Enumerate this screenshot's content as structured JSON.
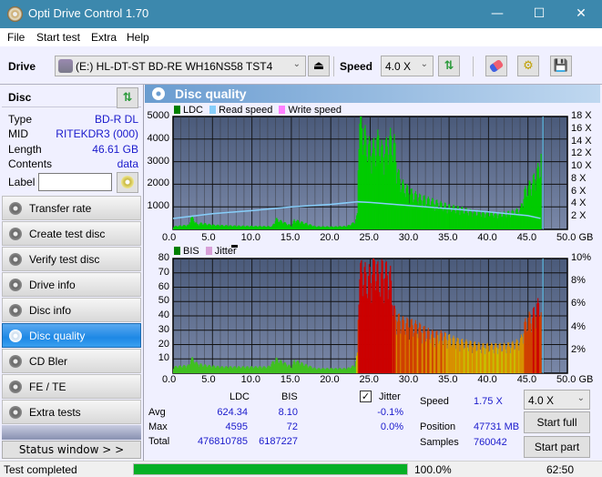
{
  "window": {
    "title": "Opti Drive Control 1.70",
    "minimize": "—",
    "maximize": "☐",
    "close": "✕"
  },
  "menu": [
    "File",
    "Start test",
    "Extra",
    "Help"
  ],
  "toolbar": {
    "drive_label": "Drive",
    "drive_value": "(E:)  HL-DT-ST BD-RE  WH16NS58 TST4",
    "speed_label": "Speed",
    "speed_value": "4.0 X",
    "icons": [
      "eject-icon",
      "refresh-icon",
      "erase-icon",
      "settings-icon",
      "save-icon"
    ]
  },
  "disc": {
    "header": "Disc",
    "rows": [
      {
        "key": "Type",
        "value": "BD-R DL"
      },
      {
        "key": "MID",
        "value": "RITEKDR3 (000)"
      },
      {
        "key": "Length",
        "value": "46.61 GB"
      },
      {
        "key": "Contents",
        "value": "data"
      }
    ],
    "label_key": "Label",
    "label_value": ""
  },
  "nav": [
    {
      "label": "Transfer rate",
      "active": false
    },
    {
      "label": "Create test disc",
      "active": false
    },
    {
      "label": "Verify test disc",
      "active": false
    },
    {
      "label": "Drive info",
      "active": false
    },
    {
      "label": "Disc info",
      "active": false
    },
    {
      "label": "Disc quality",
      "active": true
    },
    {
      "label": "CD Bler",
      "active": false
    },
    {
      "label": "FE / TE",
      "active": false
    },
    {
      "label": "Extra tests",
      "active": false
    }
  ],
  "status_window_button": "Status window > >",
  "panel_title": "Disc quality",
  "chart_data": [
    {
      "type": "area",
      "title": "LDC / Read speed",
      "legend": [
        {
          "name": "LDC",
          "color": "#008000"
        },
        {
          "name": "Read speed",
          "color": "#87cefa"
        },
        {
          "name": "Write speed",
          "color": "#ff80ff"
        }
      ],
      "xlabel": "GB",
      "xlim": [
        0,
        50
      ],
      "x_ticks": [
        "0.0",
        "5.0",
        "10.0",
        "15.0",
        "20.0",
        "25.0",
        "30.0",
        "35.0",
        "40.0",
        "45.0",
        "50.0 GB"
      ],
      "ylim": [
        0,
        5000
      ],
      "y_ticks": [
        "5000",
        "4000",
        "3000",
        "2000",
        "1000"
      ],
      "y2lim": [
        0,
        18
      ],
      "y2_ticks": [
        "18 X",
        "16 X",
        "14 X",
        "12 X",
        "10 X",
        "8 X",
        "6 X",
        "4 X",
        "2 X"
      ],
      "grid": true,
      "series": [
        {
          "name": "LDC",
          "x": [
            0,
            1,
            2,
            2.2,
            3,
            3.5,
            5,
            7,
            10,
            12.5,
            13,
            15,
            15.3,
            18,
            20,
            22,
            23,
            23.3,
            23.5,
            24,
            24.5,
            25,
            25.5,
            26,
            26.5,
            27,
            27.5,
            28,
            28.5,
            29,
            30,
            31,
            32,
            33,
            34,
            35,
            36,
            37,
            38,
            39,
            40,
            41,
            42,
            43,
            44,
            44.5,
            45,
            45.5,
            46,
            46.5,
            46.7
          ],
          "values": [
            120,
            150,
            180,
            550,
            200,
            250,
            180,
            150,
            130,
            120,
            420,
            140,
            380,
            120,
            110,
            130,
            300,
            600,
            4595,
            4000,
            3500,
            3200,
            3300,
            3600,
            3100,
            3300,
            3600,
            3400,
            2200,
            1800,
            1500,
            1300,
            1200,
            1100,
            1000,
            900,
            850,
            780,
            700,
            680,
            650,
            620,
            640,
            700,
            800,
            1500,
            1700,
            1900,
            2200,
            2600,
            3300
          ]
        },
        {
          "name": "Read speed",
          "x": [
            0,
            5,
            10,
            15,
            20,
            23.4,
            25,
            30,
            35,
            40,
            45,
            46.6
          ],
          "values": [
            1.75,
            2.5,
            3.0,
            3.6,
            4.0,
            4.4,
            4.3,
            3.8,
            3.3,
            2.8,
            2.2,
            1.75
          ]
        }
      ]
    },
    {
      "type": "bar",
      "title": "BIS / Jitter",
      "legend": [
        {
          "name": "BIS",
          "color": "#008000"
        },
        {
          "name": "Jitter",
          "color": "#d8a0d8"
        }
      ],
      "xlabel": "GB",
      "xlim": [
        0,
        50
      ],
      "x_ticks": [
        "0.0",
        "5.0",
        "10.0",
        "15.0",
        "20.0",
        "25.0",
        "30.0",
        "35.0",
        "40.0",
        "45.0",
        "50.0 GB"
      ],
      "ylim": [
        0,
        80
      ],
      "y_ticks": [
        "80",
        "70",
        "60",
        "50",
        "40",
        "30",
        "20",
        "10"
      ],
      "y2lim": [
        0,
        10
      ],
      "y2_ticks": [
        "10%",
        "8%",
        "6%",
        "4%",
        "2%"
      ],
      "grid": true,
      "series": [
        {
          "name": "BIS",
          "x": [
            0,
            2,
            2.2,
            3,
            4,
            6,
            8,
            10,
            12,
            13,
            15,
            15.3,
            18,
            20,
            22,
            23,
            23.3,
            23.5,
            24,
            24.5,
            25,
            25.5,
            26,
            26.5,
            27,
            27.5,
            28,
            28.5,
            29,
            30,
            31,
            32,
            33,
            34,
            35,
            36,
            37,
            38,
            39,
            40,
            41,
            42,
            43,
            44,
            44.5,
            45,
            45.5,
            46,
            46.5,
            46.7
          ],
          "values": [
            4,
            5,
            10,
            6,
            5,
            4,
            4,
            4,
            4,
            9,
            4,
            8,
            3,
            3,
            3,
            5,
            12,
            62,
            65,
            60,
            62,
            72,
            60,
            65,
            63,
            60,
            38,
            34,
            32,
            31,
            29,
            26,
            24,
            24,
            22,
            20,
            19,
            18,
            17,
            17,
            17,
            17,
            18,
            20,
            30,
            34,
            36,
            40,
            45,
            30
          ]
        }
      ]
    }
  ],
  "stats": {
    "col_ldc": "LDC",
    "col_bis": "BIS",
    "rows": [
      {
        "label": "Avg",
        "ldc": "624.34",
        "bis": "8.10",
        "jitter": "-0.1%"
      },
      {
        "label": "Max",
        "ldc": "4595",
        "bis": "72",
        "jitter": "0.0%"
      },
      {
        "label": "Total",
        "ldc": "476810785",
        "bis": "6187227",
        "jitter": ""
      }
    ],
    "jitter_label": "Jitter",
    "jitter_checked": true,
    "speed_label": "Speed",
    "speed_value": "1.75 X",
    "position_label": "Position",
    "position_value": "47731 MB",
    "samples_label": "Samples",
    "samples_value": "760042",
    "speed_select": "4.0 X",
    "start_full": "Start full",
    "start_part": "Start part"
  },
  "statusbar": {
    "text": "Test completed",
    "progress_percent": 100,
    "progress_text": "100.0%",
    "time": "62:50"
  }
}
